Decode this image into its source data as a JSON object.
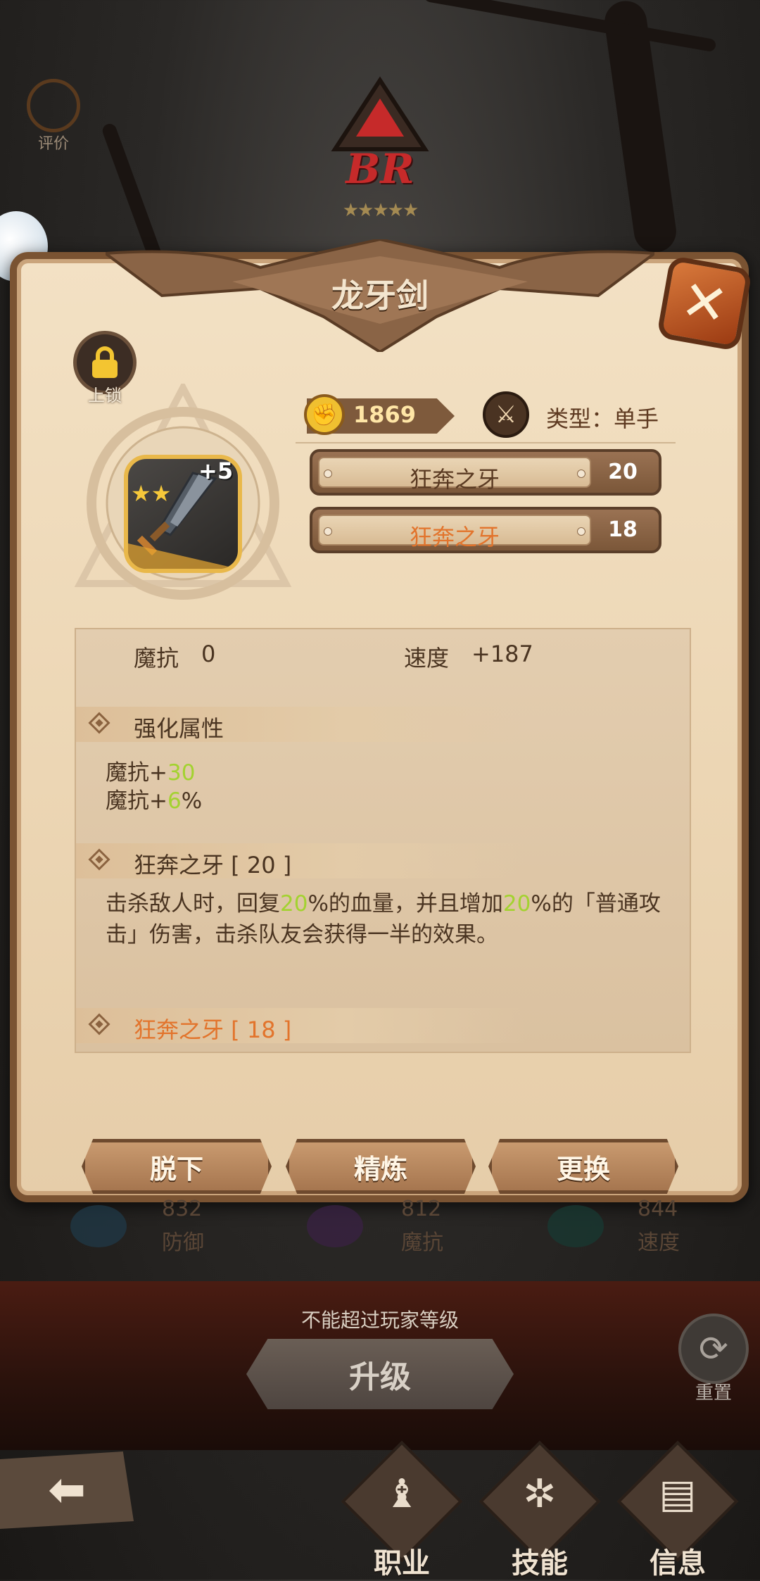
{
  "top": {
    "rate_label": "评价",
    "rank_text": "BR",
    "stars": "★★★★★"
  },
  "panel": {
    "title": "龙牙剑",
    "lock_label": "上锁",
    "item": {
      "level": "+5",
      "stars": "★★"
    },
    "power": "1869",
    "type_label": "类型：单手",
    "skills": [
      {
        "name": "狂奔之牙",
        "level": "20",
        "color": "#5a3a22"
      },
      {
        "name": "狂奔之牙",
        "level": "18",
        "color": "#e2742c"
      }
    ],
    "stats": {
      "left_label": "魔抗",
      "left_value": "0",
      "right_label": "速度",
      "right_value": "+187"
    },
    "enhance": {
      "title": "强化属性",
      "lines": [
        {
          "prefix": "魔抗+",
          "value": "30"
        },
        {
          "prefix": "魔抗+",
          "value": "6",
          "suffix": "%"
        }
      ]
    },
    "skill_sections": [
      {
        "title": "狂奔之牙 [ 20 ]",
        "desc": [
          {
            "t": "击杀敌人时，回复"
          },
          {
            "t": "20",
            "g": true
          },
          {
            "t": "%的血量，并且增加"
          },
          {
            "t": "20",
            "g": true
          },
          {
            "t": "%的「普通攻击」伤害，击杀队友会获得一半的效果。"
          }
        ]
      },
      {
        "title": "狂奔之牙 [ 18 ]"
      }
    ],
    "buttons": {
      "unequip": "脱下",
      "refine": "精炼",
      "replace": "更换"
    }
  },
  "behind": {
    "stats": [
      {
        "value": "832",
        "label": "防御"
      },
      {
        "value": "812",
        "label": "魔抗"
      },
      {
        "value": "844",
        "label": "速度"
      }
    ],
    "upgrade_note": "不能超过玩家等级",
    "upgrade_label": "升级",
    "reset_label": "重置"
  },
  "nav": {
    "class_label": "职业",
    "skill_label": "技能",
    "info_label": "信息"
  }
}
